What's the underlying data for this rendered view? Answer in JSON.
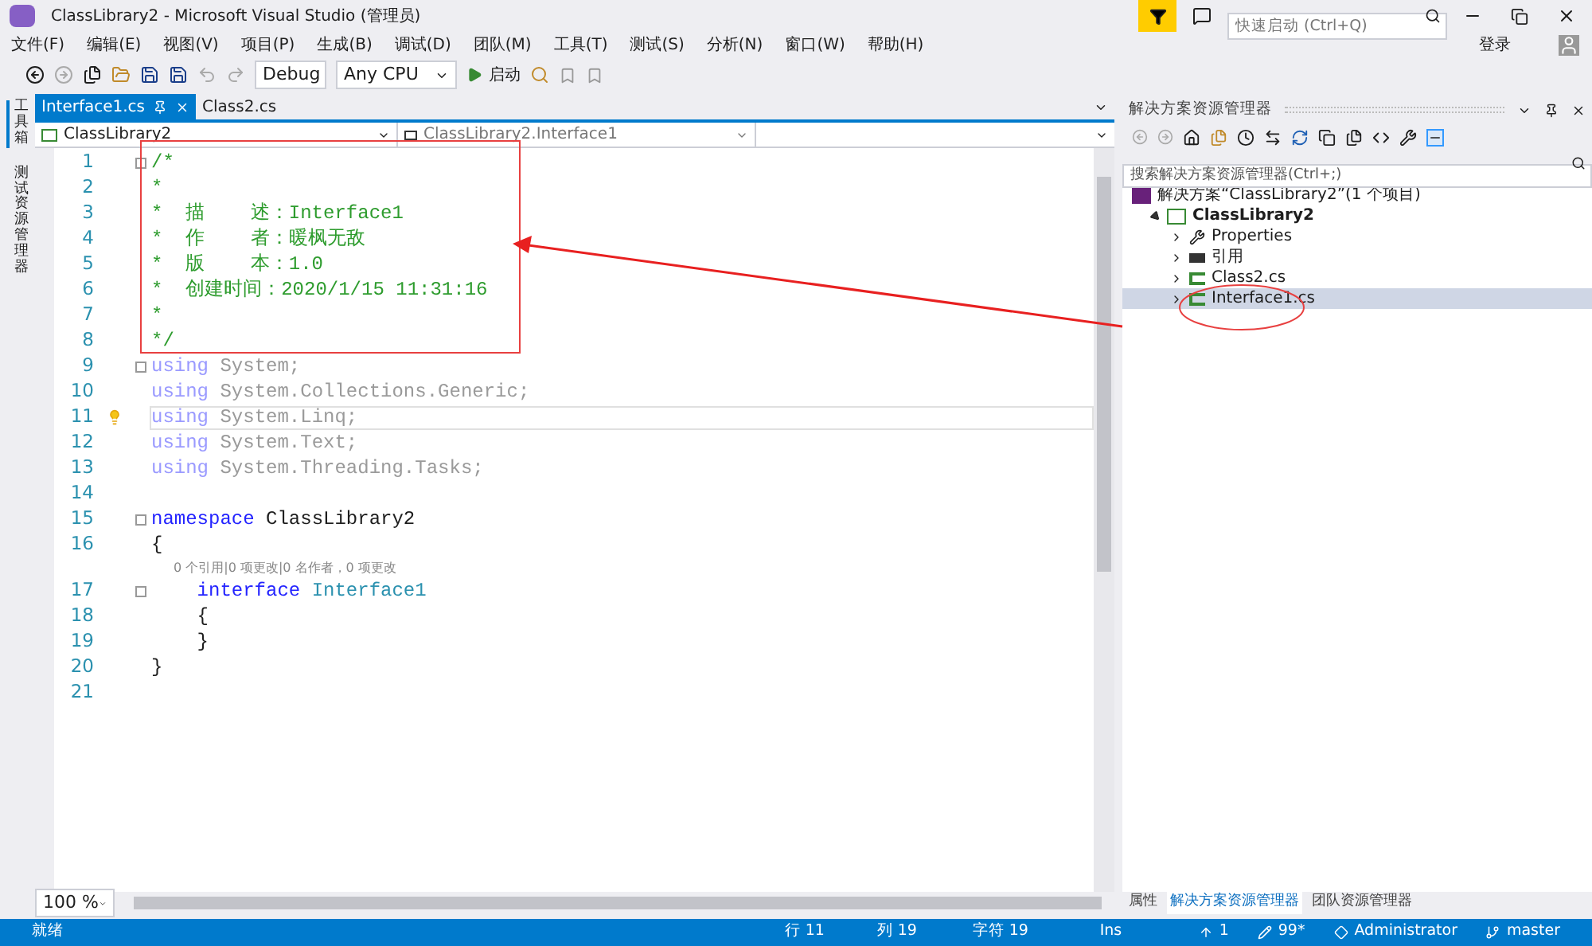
{
  "window": {
    "title": "ClassLibrary2 - Microsoft Visual Studio (管理员)",
    "quick_launch": {
      "placeholder": "快速启动 (Ctrl+Q)"
    },
    "sign_in": "登录"
  },
  "menu": [
    "文件(F)",
    "编辑(E)",
    "视图(V)",
    "项目(P)",
    "生成(B)",
    "调试(D)",
    "团队(M)",
    "工具(T)",
    "测试(S)",
    "分析(N)",
    "窗口(W)",
    "帮助(H)"
  ],
  "toolbar": {
    "configuration": "Debug",
    "platform": "Any CPU",
    "start": "启动"
  },
  "side_tabs": [
    "工具箱",
    "测试资源管理器"
  ],
  "document_tabs": [
    {
      "label": "Interface1.cs",
      "selected": true
    },
    {
      "label": "Class2.cs",
      "selected": false
    }
  ],
  "nav_bar": {
    "project": "ClassLibrary2",
    "type": "ClassLibrary2.Interface1"
  },
  "code_lines": [
    {
      "kind": "code",
      "number": "1",
      "fold": true,
      "current": false,
      "tokens": [
        {
          "kind": "comment",
          "text": "/*"
        }
      ]
    },
    {
      "kind": "code",
      "number": "2",
      "fold": false,
      "current": false,
      "tokens": [
        {
          "kind": "comment",
          "text": "*"
        }
      ]
    },
    {
      "kind": "code",
      "number": "3",
      "fold": false,
      "current": false,
      "tokens": [
        {
          "kind": "comment",
          "text": "*  描    述：Interface1"
        }
      ]
    },
    {
      "kind": "code",
      "number": "4",
      "fold": false,
      "current": false,
      "tokens": [
        {
          "kind": "comment",
          "text": "*  作    者：暖枫无敌"
        }
      ]
    },
    {
      "kind": "code",
      "number": "5",
      "fold": false,
      "current": false,
      "tokens": [
        {
          "kind": "comment",
          "text": "*  版    本：1.0"
        }
      ]
    },
    {
      "kind": "code",
      "number": "6",
      "fold": false,
      "current": false,
      "tokens": [
        {
          "kind": "comment",
          "text": "*  创建时间：2020/1/15 11:31:16"
        }
      ]
    },
    {
      "kind": "code",
      "number": "7",
      "fold": false,
      "current": false,
      "tokens": [
        {
          "kind": "comment",
          "text": "*"
        }
      ]
    },
    {
      "kind": "code",
      "number": "8",
      "fold": false,
      "current": false,
      "tokens": [
        {
          "kind": "comment",
          "text": "*/"
        }
      ]
    },
    {
      "kind": "code",
      "number": "9",
      "fold": true,
      "current": false,
      "tokens": [
        {
          "kind": "unused_keyword",
          "text": "using"
        },
        {
          "kind": "unused",
          "text": " System;"
        }
      ]
    },
    {
      "kind": "code",
      "number": "10",
      "fold": false,
      "current": false,
      "tokens": [
        {
          "kind": "unused_keyword",
          "text": "using"
        },
        {
          "kind": "unused",
          "text": " System.Collections.Generic;"
        }
      ]
    },
    {
      "kind": "code",
      "number": "11",
      "fold": false,
      "current": true,
      "tokens": [
        {
          "kind": "unused_keyword",
          "text": "using"
        },
        {
          "kind": "unused",
          "text": " System.Linq;"
        }
      ]
    },
    {
      "kind": "code",
      "number": "12",
      "fold": false,
      "current": false,
      "tokens": [
        {
          "kind": "unused_keyword",
          "text": "using"
        },
        {
          "kind": "unused",
          "text": " System.Text;"
        }
      ]
    },
    {
      "kind": "code",
      "number": "13",
      "fold": false,
      "current": false,
      "tokens": [
        {
          "kind": "unused_keyword",
          "text": "using"
        },
        {
          "kind": "unused",
          "text": " System.Threading.Tasks;"
        }
      ]
    },
    {
      "kind": "code",
      "number": "14",
      "fold": false,
      "current": false
    },
    {
      "kind": "code",
      "number": "15",
      "fold": true,
      "current": false,
      "tokens": [
        {
          "kind": "keyword",
          "text": "namespace"
        },
        {
          "kind": "plain",
          "text": " ClassLibrary2"
        }
      ]
    },
    {
      "kind": "code",
      "number": "16",
      "fold": false,
      "current": false,
      "tokens": [
        {
          "kind": "plain",
          "text": "{"
        }
      ]
    },
    {
      "kind": "codelens",
      "text": "0 个引用|0 项更改|0 名作者，0 项更改"
    },
    {
      "kind": "code",
      "number": "17",
      "fold": true,
      "current": false,
      "tokens": [
        {
          "kind": "keyword",
          "text": "    interface"
        },
        {
          "kind": "type",
          "text": " Interface1"
        }
      ]
    },
    {
      "kind": "code",
      "number": "18",
      "fold": false,
      "current": false,
      "tokens": [
        {
          "kind": "plain",
          "text": "    {"
        }
      ]
    },
    {
      "kind": "code",
      "number": "19",
      "fold": false,
      "current": false,
      "tokens": [
        {
          "kind": "plain",
          "text": "    }"
        }
      ]
    },
    {
      "kind": "code",
      "number": "20",
      "fold": false,
      "current": false,
      "tokens": [
        {
          "kind": "plain",
          "text": "}"
        }
      ]
    },
    {
      "kind": "code",
      "number": "21",
      "fold": false,
      "current": false
    }
  ],
  "zoom": "100 %",
  "solution_explorer": {
    "title": "解决方案资源管理器",
    "search": {
      "placeholder": "搜索解决方案资源管理器(Ctrl+;)"
    },
    "tree": [
      {
        "label": "解决方案“ClassLibrary2”(1 个项目)",
        "kind": "solution",
        "bold": false,
        "selected": false,
        "children": [
          {
            "label": "ClassLibrary2",
            "kind": "project",
            "bold": true,
            "expanded": true,
            "selected": false,
            "children": [
              {
                "label": "Properties",
                "kind": "properties",
                "bold": false,
                "expanded": false,
                "selected": false
              },
              {
                "label": "引用",
                "kind": "references",
                "bold": false,
                "expanded": false,
                "selected": false
              },
              {
                "label": "Class2.cs",
                "kind": "csharp",
                "bold": false,
                "expanded": false,
                "selected": false
              },
              {
                "label": "Interface1.cs",
                "kind": "csharp",
                "bold": false,
                "expanded": false,
                "selected": true
              }
            ]
          }
        ]
      }
    ]
  },
  "bottom_tabs": [
    {
      "label": "属性",
      "selected": false
    },
    {
      "label": "解决方案资源管理器",
      "selected": true
    },
    {
      "label": "团队资源管理器",
      "selected": false
    }
  ],
  "status_bar": {
    "state": "就绪",
    "line": "行 11",
    "column": "列 19",
    "char": "字符 19",
    "mode": "Ins",
    "pushes": "1",
    "changes": "99*",
    "user": "Administrator",
    "branch": "master"
  }
}
